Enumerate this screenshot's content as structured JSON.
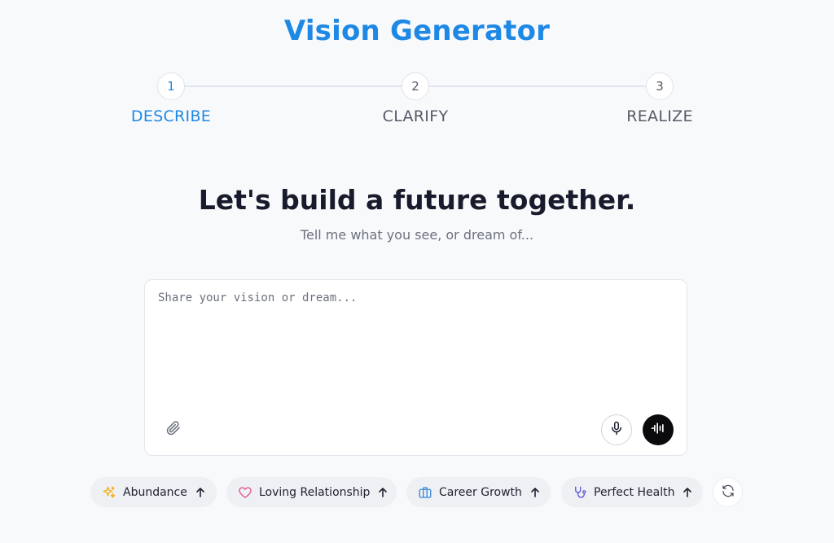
{
  "app": {
    "title": "Vision Generator"
  },
  "stepper": {
    "steps": [
      {
        "number": "1",
        "label": "DESCRIBE",
        "active": true
      },
      {
        "number": "2",
        "label": "CLARIFY",
        "active": false
      },
      {
        "number": "3",
        "label": "REALIZE",
        "active": false
      }
    ]
  },
  "hero": {
    "headline": "Let's build a future together.",
    "subline": "Tell me what you see, or dream of..."
  },
  "composer": {
    "placeholder": "Share your vision or dream...",
    "value": "",
    "icons": {
      "attach": "paperclip-icon",
      "mic": "microphone-icon",
      "voice": "waveform-icon"
    }
  },
  "suggestions": [
    {
      "label": "Abundance",
      "icon": "sparkles-icon",
      "icon_color": "#f2b01e"
    },
    {
      "label": "Loving Relationship",
      "icon": "heart-icon",
      "icon_color": "#e0568a"
    },
    {
      "label": "Career Growth",
      "icon": "briefcase-icon",
      "icon_color": "#3a86d8"
    },
    {
      "label": "Perfect Health",
      "icon": "stethoscope-icon",
      "icon_color": "#5b56d6"
    }
  ],
  "colors": {
    "accent": "#1e88e5",
    "background": "#f8f9fb",
    "text": "#181b2b",
    "muted": "#6b717d"
  }
}
